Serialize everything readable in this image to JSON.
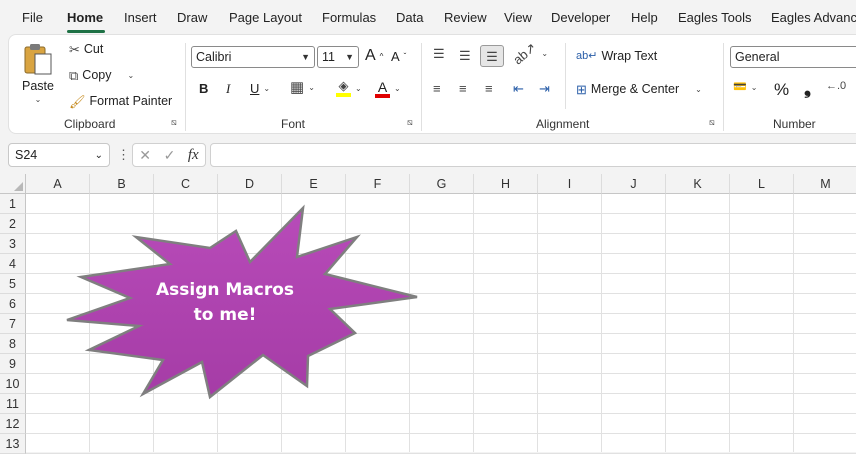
{
  "menu": {
    "tabs": [
      "File",
      "Home",
      "Insert",
      "Draw",
      "Page Layout",
      "Formulas",
      "Data",
      "Review",
      "View",
      "Developer",
      "Help",
      "Eagles Tools",
      "Eagles Advanc"
    ]
  },
  "clipboard": {
    "paste": "Paste",
    "cut": "Cut",
    "copy": "Copy",
    "format_painter": "Format Painter",
    "label": "Clipboard"
  },
  "font": {
    "name": "Calibri",
    "size": "11",
    "bold": "B",
    "italic": "I",
    "underline": "U",
    "label": "Font",
    "increase_icon": "A",
    "decrease_icon": "A",
    "font_color_letter": "A"
  },
  "alignment": {
    "wrap_text": "Wrap Text",
    "merge_center": "Merge & Center",
    "label": "Alignment"
  },
  "number": {
    "format": "General",
    "percent": "%",
    "comma": "❟",
    "label": "Number"
  },
  "formula_bar": {
    "name_box": "S24",
    "fx": "fx"
  },
  "grid": {
    "columns": [
      "A",
      "B",
      "C",
      "D",
      "E",
      "F",
      "G",
      "H",
      "I",
      "J",
      "K",
      "L",
      "M"
    ],
    "rows": [
      "1",
      "2",
      "3",
      "4",
      "5",
      "6",
      "7",
      "8",
      "9",
      "10",
      "11",
      "12",
      "13"
    ]
  },
  "shape": {
    "line1": "Assign Macros",
    "line2": "to me!",
    "fill": "#a53ca6",
    "stroke": "#7f7f7f"
  },
  "colors": {
    "accent": "#1e7145",
    "highlight": "#ffff00",
    "font_red": "#e00000"
  }
}
